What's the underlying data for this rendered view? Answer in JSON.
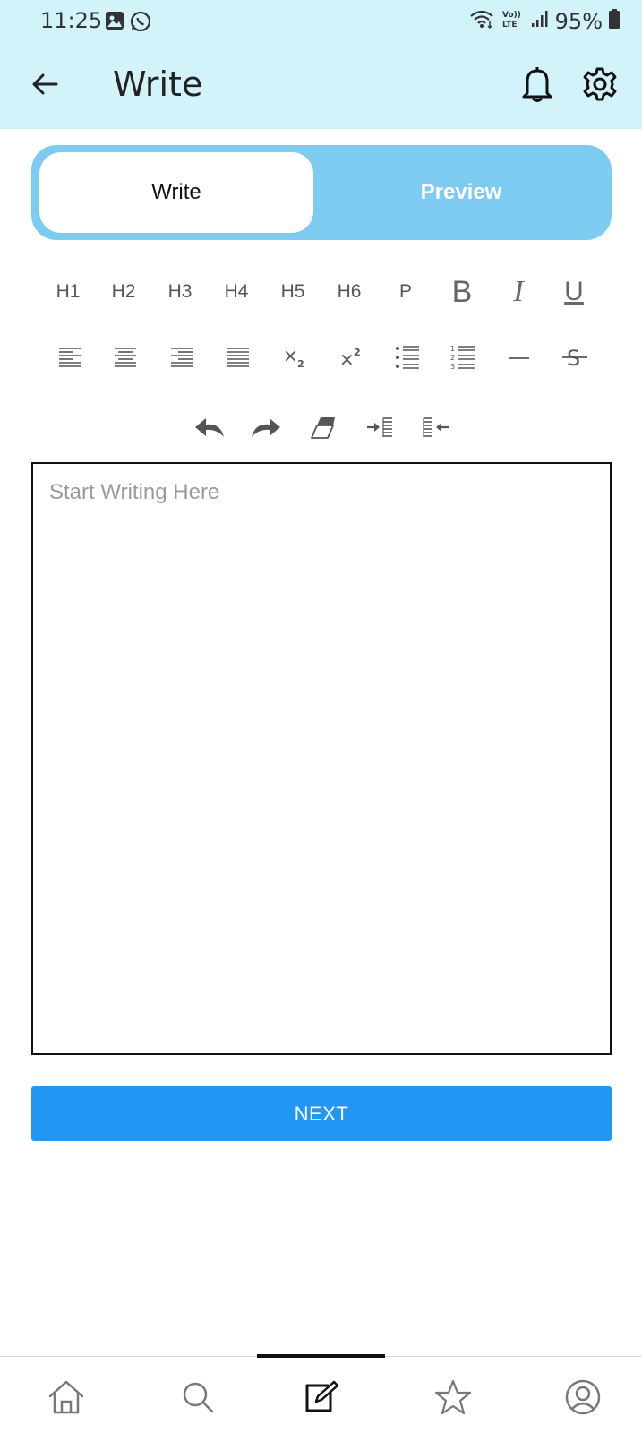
{
  "status_bar": {
    "time": "11:25",
    "battery": "95%",
    "left_icons": [
      "gallery-icon",
      "whatsapp-icon"
    ],
    "right_icons": [
      "wifi-icon",
      "volte-icon",
      "signal-icon",
      "battery-icon"
    ]
  },
  "app_bar": {
    "title": "Write",
    "back_icon": "arrow-left-icon",
    "actions": [
      "bell-icon",
      "gear-icon"
    ]
  },
  "segmented": {
    "write_label": "Write",
    "preview_label": "Preview",
    "active": "Write",
    "accent_color": "#7ecbf1"
  },
  "toolbar": {
    "row1": [
      "H1",
      "H2",
      "H3",
      "H4",
      "H5",
      "H6",
      "P",
      "B",
      "I",
      "U"
    ],
    "row2": [
      "align-left-icon",
      "align-center-icon",
      "align-right-icon",
      "align-justify-icon",
      "subscript-icon",
      "superscript-icon",
      "bullet-list-icon",
      "numbered-list-icon",
      "horizontal-rule-icon",
      "strikethrough-icon"
    ],
    "row3": [
      "undo-icon",
      "redo-icon",
      "eraser-icon",
      "indent-icon",
      "outdent-icon"
    ]
  },
  "editor": {
    "placeholder": "Start Writing Here",
    "value": ""
  },
  "next_button": {
    "label": "NEXT",
    "color": "#2196f3"
  },
  "bottom_nav": {
    "items": [
      "home-icon",
      "search-icon",
      "write-icon",
      "star-icon",
      "profile-icon"
    ]
  }
}
